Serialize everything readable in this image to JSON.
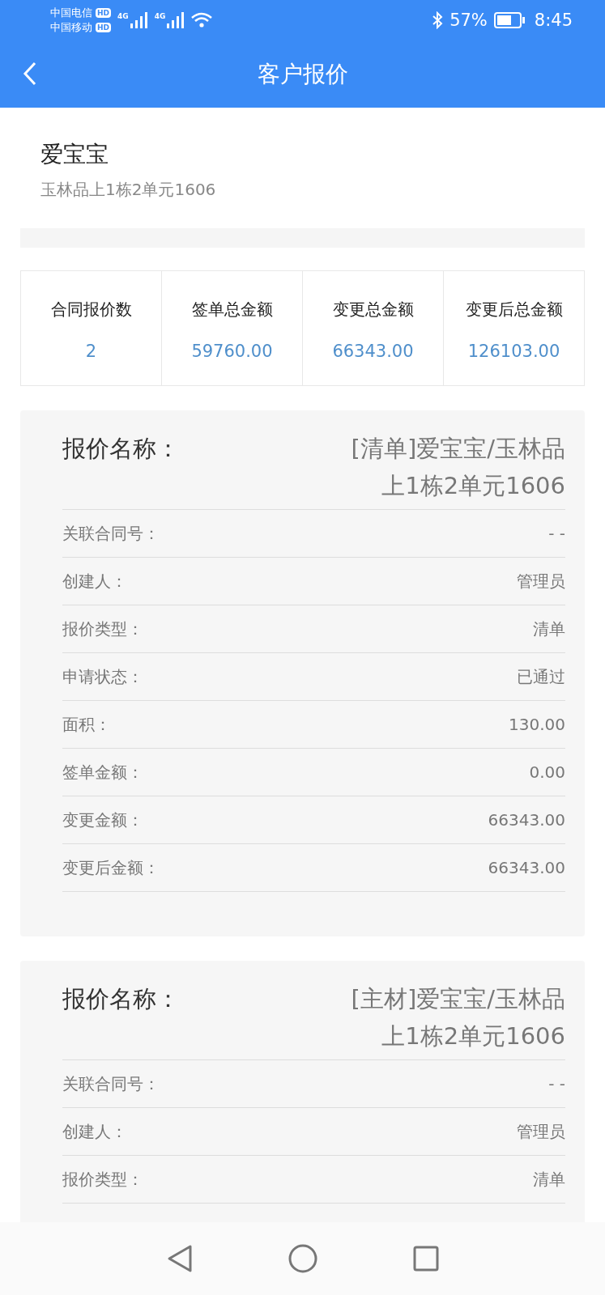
{
  "status_bar": {
    "carriers": [
      {
        "name": "中国电信",
        "badge": "HD"
      },
      {
        "name": "中国移动",
        "badge": "HD"
      }
    ],
    "network_labels": [
      "4G",
      "4G"
    ],
    "battery": "57%",
    "time": "8:45"
  },
  "nav": {
    "title": "客户报价"
  },
  "customer": {
    "name": "爱宝宝",
    "address": "玉林品上1栋2单元1606"
  },
  "stats": [
    {
      "label": "合同报价数",
      "value": "2"
    },
    {
      "label": "签单总金额",
      "value": "59760.00"
    },
    {
      "label": "变更总金额",
      "value": "66343.00"
    },
    {
      "label": "变更后总金额",
      "value": "126103.00"
    }
  ],
  "quotes": [
    {
      "title_label": "报价名称：",
      "title_value": "[清单]爱宝宝/玉林品上1栋2单元1606",
      "rows": [
        {
          "label": "关联合同号：",
          "value": "- -"
        },
        {
          "label": "创建人：",
          "value": "管理员"
        },
        {
          "label": "报价类型：",
          "value": "清单"
        },
        {
          "label": "申请状态：",
          "value": "已通过"
        },
        {
          "label": "面积：",
          "value": "130.00"
        },
        {
          "label": "签单金额：",
          "value": "0.00"
        },
        {
          "label": "变更金额：",
          "value": "66343.00"
        },
        {
          "label": "变更后金额：",
          "value": "66343.00"
        }
      ]
    },
    {
      "title_label": "报价名称：",
      "title_value": "[主材]爱宝宝/玉林品上1栋2单元1606",
      "rows": [
        {
          "label": "关联合同号：",
          "value": "- -"
        },
        {
          "label": "创建人：",
          "value": "管理员"
        },
        {
          "label": "报价类型：",
          "value": "清单"
        }
      ]
    }
  ]
}
